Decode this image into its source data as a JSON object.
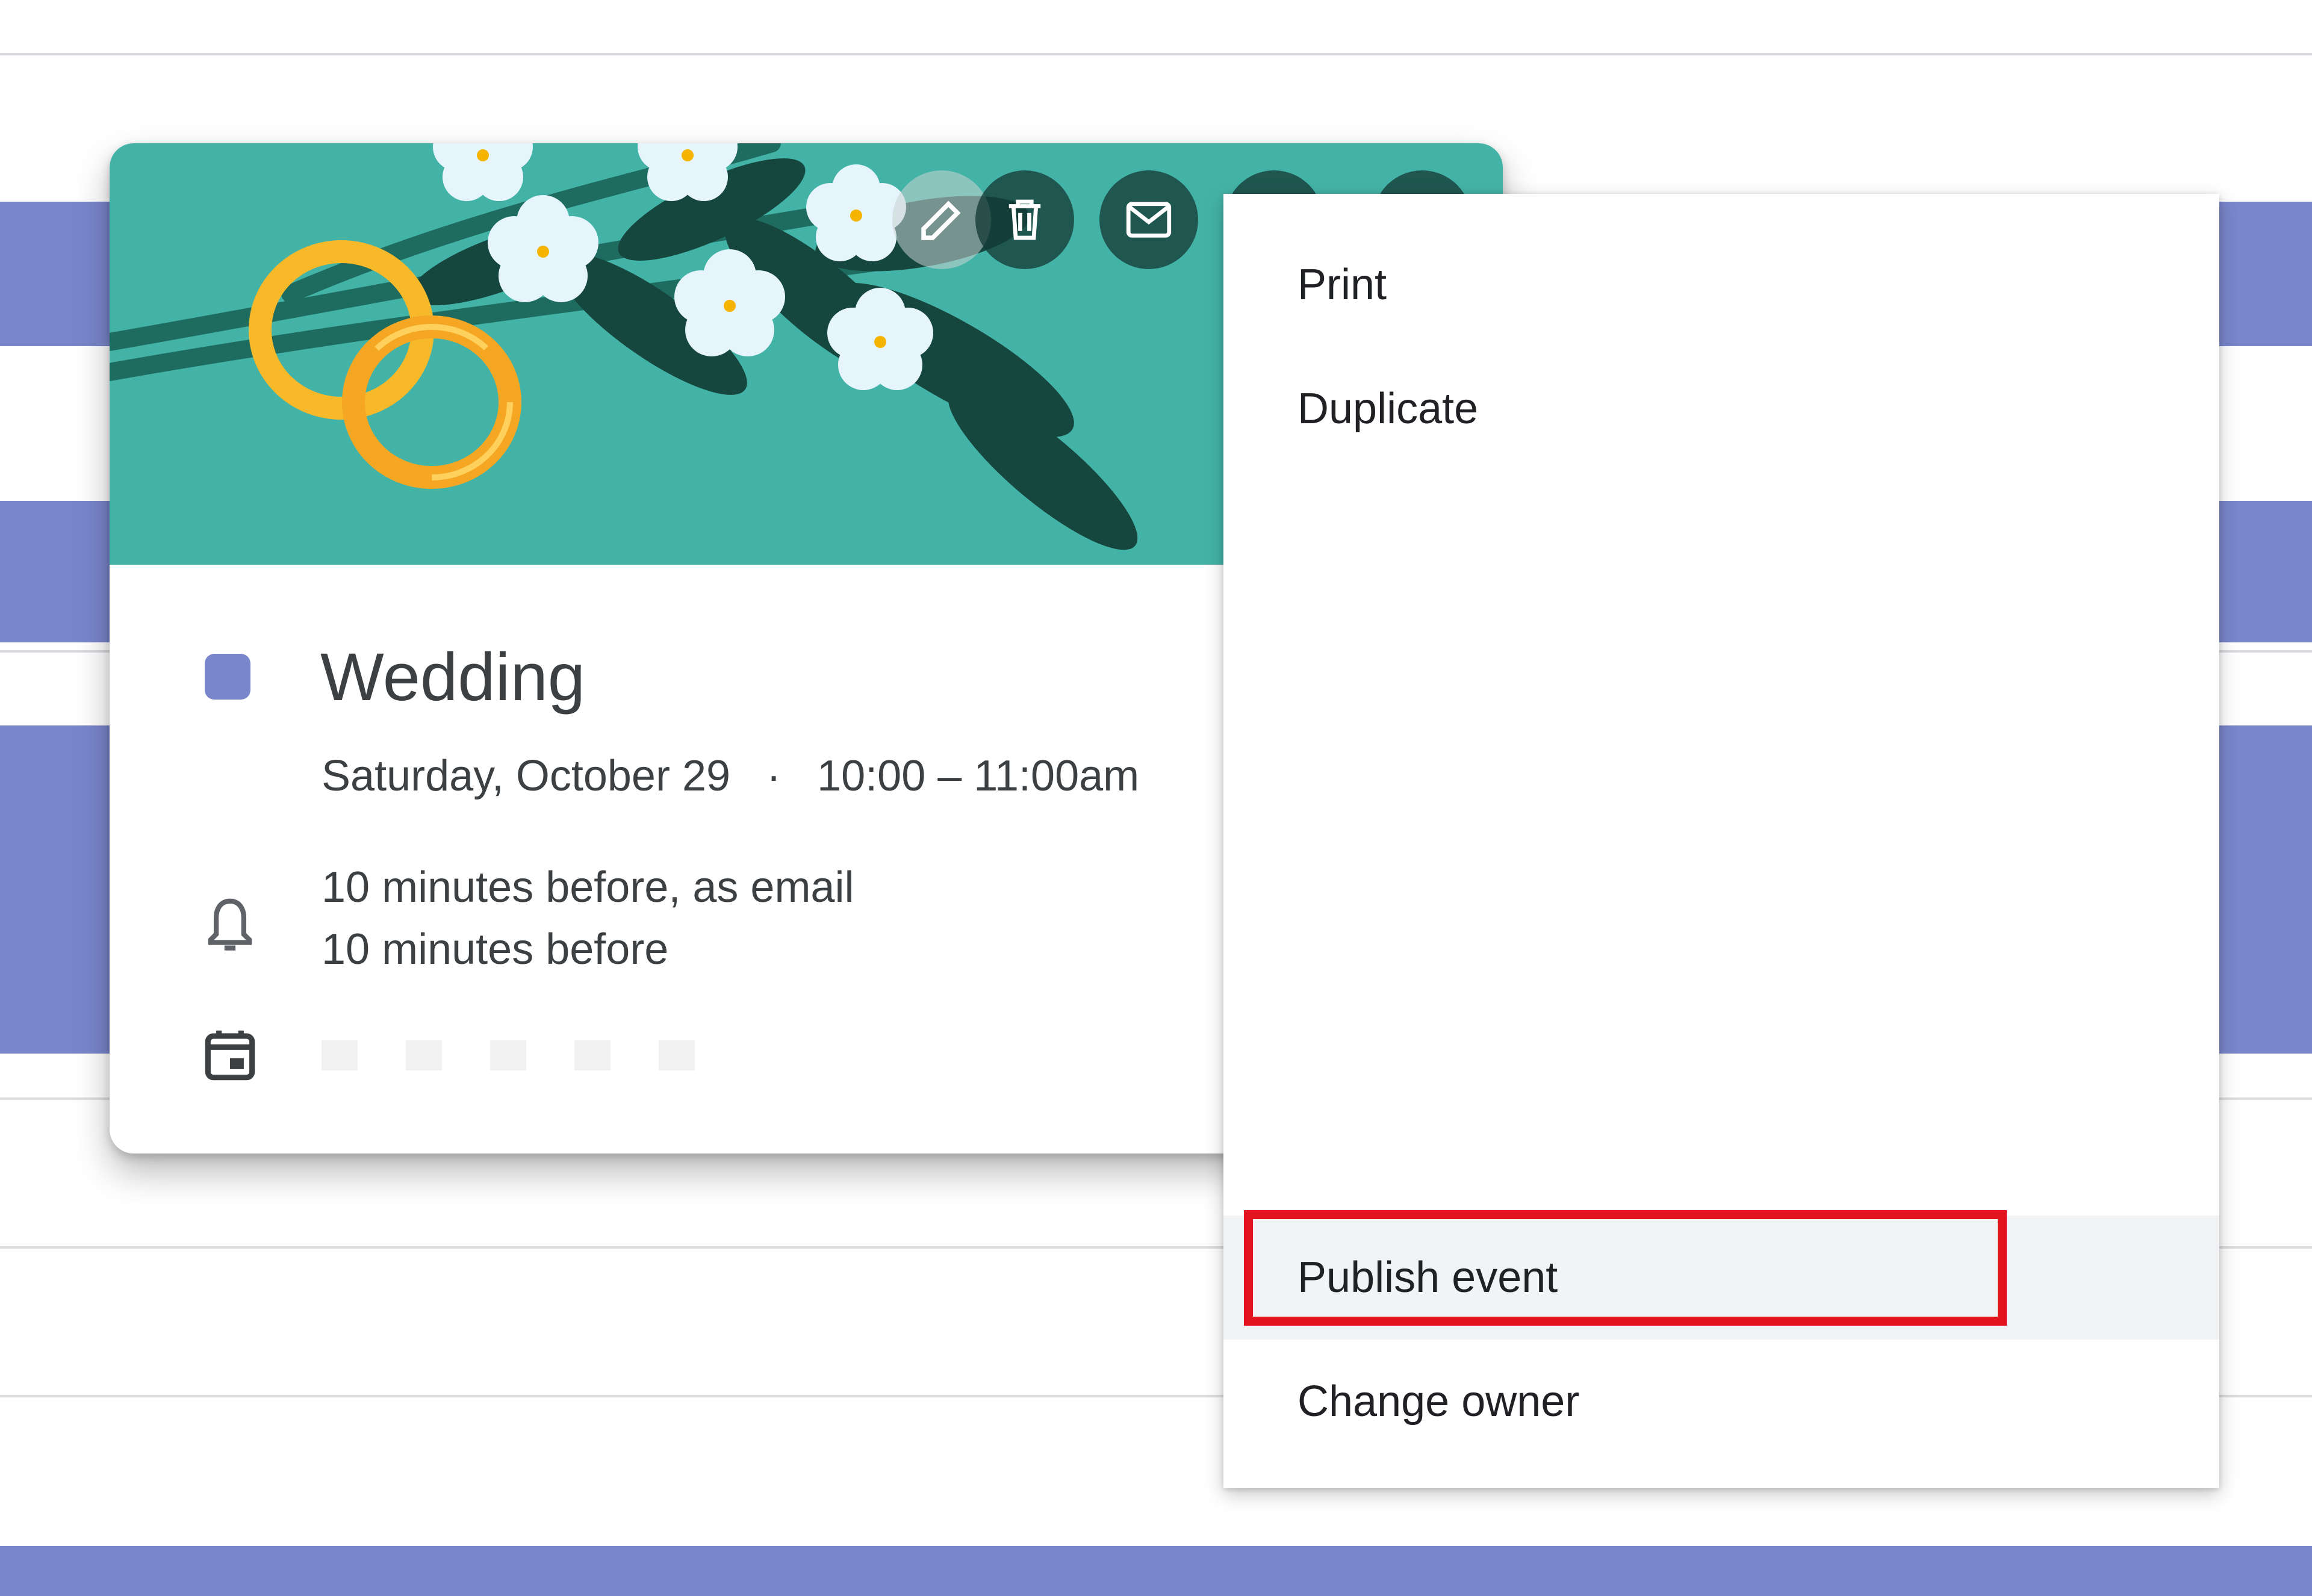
{
  "colors": {
    "event_color": "#7986cb",
    "header_teal": "#44b3a7",
    "highlight": "#e3141f",
    "menu_hover": "#f1f3f4"
  },
  "event": {
    "title": "Wedding",
    "date": "Saturday, October 29",
    "separator": "·",
    "time": "10:00 – 11:00am",
    "reminders": [
      "10 minutes before, as email",
      "10 minutes before"
    ]
  },
  "toolbar": {
    "icons": [
      "edit-icon",
      "delete-icon",
      "email-icon",
      "more-options-icon",
      "close-icon"
    ]
  },
  "menu": {
    "items": [
      {
        "label": "Print"
      },
      {
        "label": "Duplicate"
      },
      {
        "label": "Publish event",
        "highlighted": true
      },
      {
        "label": "Change owner"
      }
    ]
  }
}
